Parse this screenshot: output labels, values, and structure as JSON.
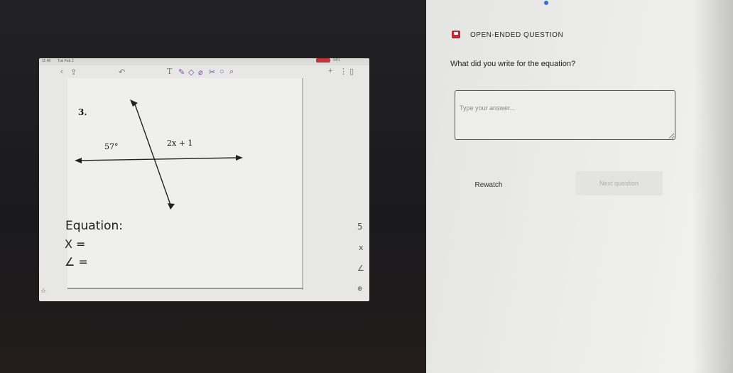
{
  "tablet": {
    "status_time": "11:48",
    "status_title": "Tue Feb 2",
    "status_right": "94%",
    "toolbar_icons": [
      "back-arrow-icon",
      "share-icon",
      "undo-icon",
      "text-tool-icon",
      "pen-icon",
      "highlighter-icon",
      "eraser-icon",
      "lasso-icon",
      "shape-icon",
      "pin-icon",
      "add-page-icon",
      "more-icon",
      "sidebar-icon"
    ],
    "problem_number": "3.",
    "angle_label": "57°",
    "expr_label": "2x + 1",
    "equation_label": "Equation:",
    "x_label": "X =",
    "angle_eq_label": "∠ ="
  },
  "question": {
    "type_label": "OPEN-ENDED QUESTION",
    "prompt": "What did you write for the equation?",
    "answer_placeholder": "Type your answer...",
    "answer_value": "",
    "rewatch_label": "Rewatch",
    "next_label": "Next question"
  },
  "colors": {
    "badge_red": "#c0262e",
    "battery_red": "#c2343b",
    "pen_purple": "#7a4aa8"
  }
}
